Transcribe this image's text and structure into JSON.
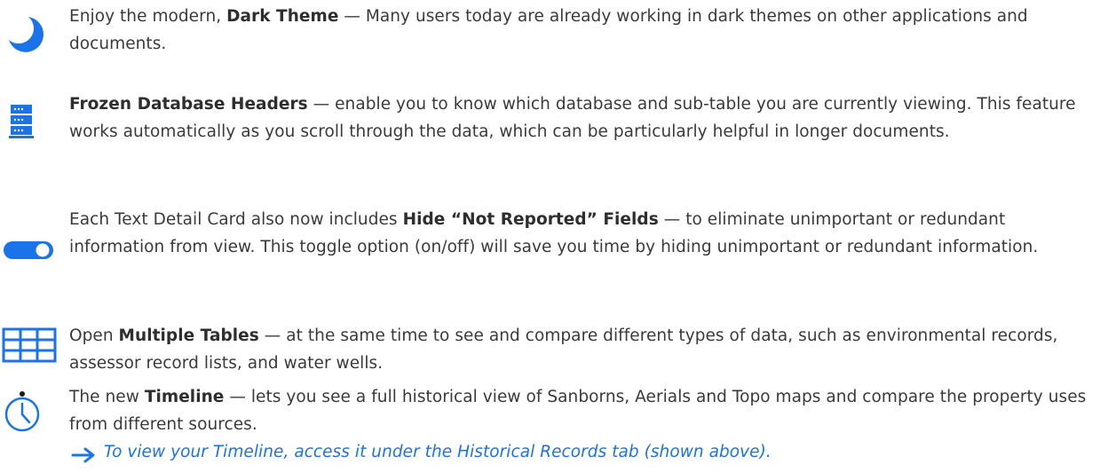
{
  "features": [
    {
      "icon": "moon-icon",
      "pre": "Enjoy the modern, ",
      "bold": "Dark Theme",
      "post": " — Many users today are already working in dark themes on other applications and documents."
    },
    {
      "icon": "database-headers-icon",
      "pre": "",
      "bold": "Frozen Database Headers",
      "post": " — enable you to know which database and sub-table you are currently viewing. This feature works automatically as you scroll through the data, which can be particularly helpful in longer documents."
    },
    {
      "icon": "toggle-icon",
      "pre": "Each Text Detail Card also now includes ",
      "bold": "Hide “Not Reported” Fields",
      "post": " — to eliminate unimportant or redundant information from view. This toggle option (on/off) will save you time by hiding unimportant or redundant information."
    },
    {
      "icon": "table-grid-icon",
      "pre": "Open ",
      "bold": "Multiple Tables",
      "post": " — at the same time to see and compare different types of data, such as environmental records, assessor record lists, and water wells."
    },
    {
      "icon": "clock-icon",
      "pre": "The new ",
      "bold": "Timeline",
      "post": " — lets you see a full historical view of Sanborns, Aerials and Topo maps and compare the property uses from different sources."
    }
  ],
  "note": {
    "icon": "arrow-right-icon",
    "text": "To view your Timeline, access it under the Historical Records tab (shown above)."
  },
  "colors": {
    "accent": "#1a73e8",
    "text": "#3a3a3a"
  }
}
